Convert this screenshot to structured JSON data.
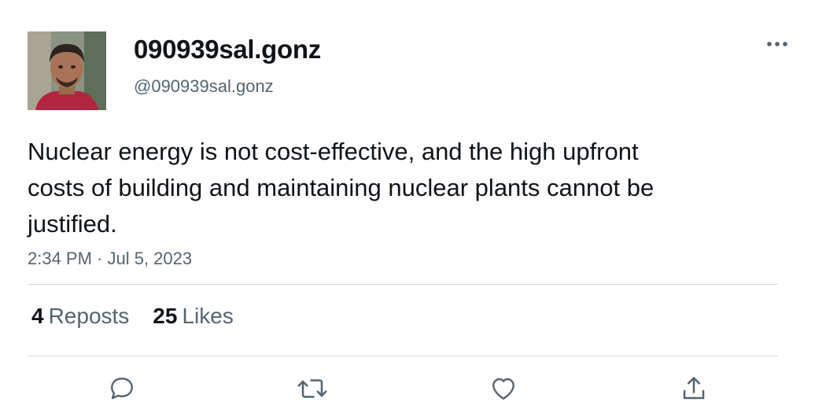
{
  "author": {
    "display_name": "090939sal.gonz",
    "handle": "@090939sal.gonz"
  },
  "tweet": {
    "text": "Nuclear energy is not cost-effective, and the high upfront costs of building and maintaining nuclear plants cannot be justified.",
    "timestamp": "2:34 PM · Jul 5, 2023"
  },
  "stats": {
    "reposts_count": "4",
    "reposts_label": "Reposts",
    "likes_count": "25",
    "likes_label": "Likes"
  },
  "icons": {
    "more": "more-horizontal-icon",
    "reply": "reply-icon",
    "repost": "repost-icon",
    "like": "heart-icon",
    "share": "share-icon"
  },
  "colors": {
    "text_primary": "#0f1419",
    "text_secondary": "#536471",
    "divider": "#cfd9de",
    "icon": "#536471"
  }
}
